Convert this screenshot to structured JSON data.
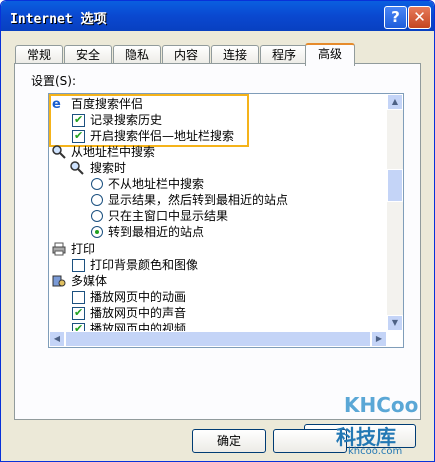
{
  "window": {
    "title": "Internet 选项",
    "help_label": "?",
    "close_label": "✕"
  },
  "tabs": [
    {
      "label": "常规"
    },
    {
      "label": "安全"
    },
    {
      "label": "隐私"
    },
    {
      "label": "内容"
    },
    {
      "label": "连接"
    },
    {
      "label": "程序"
    },
    {
      "label": "高级"
    }
  ],
  "active_tab": "高级",
  "settings_label": "设置(S):",
  "items": [
    {
      "type": "group",
      "icon": "ie-icon",
      "label": "百度搜索伴侣"
    },
    {
      "type": "checkbox",
      "checked": true,
      "label": "记录搜索历史"
    },
    {
      "type": "checkbox",
      "checked": true,
      "label": "开启搜索伴侣—地址栏搜索"
    },
    {
      "type": "group",
      "icon": "search-icon",
      "label": "从地址栏中搜索"
    },
    {
      "type": "subgroup",
      "icon": "search-icon",
      "label": "搜索时"
    },
    {
      "type": "radio",
      "selected": false,
      "label": "不从地址栏中搜索"
    },
    {
      "type": "radio",
      "selected": false,
      "label": "显示结果，然后转到最相近的站点"
    },
    {
      "type": "radio",
      "selected": false,
      "label": "只在主窗口中显示结果"
    },
    {
      "type": "radio",
      "selected": true,
      "label": "转到最相近的站点"
    },
    {
      "type": "group",
      "icon": "printer-icon",
      "label": "打印"
    },
    {
      "type": "checkbox",
      "checked": false,
      "label": "打印背景颜色和图像"
    },
    {
      "type": "group",
      "icon": "multimedia-icon",
      "label": "多媒体"
    },
    {
      "type": "checkbox",
      "checked": false,
      "label": "播放网页中的动画"
    },
    {
      "type": "checkbox",
      "checked": true,
      "label": "播放网页中的声音"
    },
    {
      "type": "checkbox",
      "checked": true,
      "label": "播放网页中的视频"
    }
  ],
  "buttons": {
    "restore": "",
    "ok": "确定",
    "cancel": ""
  },
  "watermark": {
    "brand": "KHCoo",
    "name": "科技库",
    "url": "khcoo.com"
  },
  "colors": {
    "titlebar": "#0a48d0",
    "highlight": "#f5b31a",
    "check": "#21a121"
  }
}
